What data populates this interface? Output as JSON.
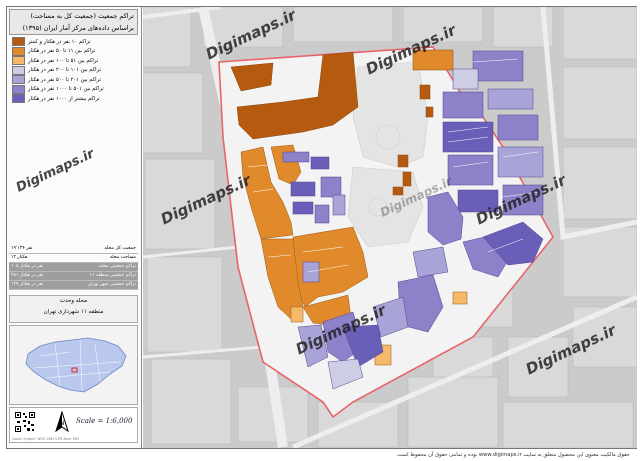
{
  "title": {
    "line1": "تراکم جمعیت (جمعیت کل به مساحت)",
    "line2": "براساس داده‌های مرکز آمار ایران (۱۳۹۵)"
  },
  "legend": [
    {
      "label": "تراکم ۱۰ نفر در هکتار و کمتر",
      "color": "#b55a0e"
    },
    {
      "label": "تراکم بین ۱۱ تا ۵۰ نفر در هکتار",
      "color": "#e08a2b"
    },
    {
      "label": "تراکم بین ۵۱ تا ۱۰۰ نفر در هکتار",
      "color": "#f5b96a"
    },
    {
      "label": "تراکم بین ۱۰۱ تا ۲۰۰ نفر در هکتار",
      "color": "#cdcde6"
    },
    {
      "label": "تراکم بین ۲۰۱ تا ۵۰۰ نفر در هکتار",
      "color": "#a9a4d7"
    },
    {
      "label": "تراکم بین ۵۰۱ تا ۱۰۰۰ نفر در هکتار",
      "color": "#8d82c9"
    },
    {
      "label": "تراکم بیشتر از ۱۰۰۰ نفر در هکتار",
      "color": "#6a5fb8"
    }
  ],
  "stats": [
    {
      "label": "جمعیت کل محله",
      "value": "۱۹٬۱۳۴ نفر"
    },
    {
      "label": "مساحت محله",
      "value": "۱۲ هکتار"
    },
    {
      "label": "تراکم جمعیتی محله",
      "value": "۱۰۸ نفر در هکتار"
    },
    {
      "label": "تراکم جمعیتی منطقه ۱۱",
      "value": "۲۸۱ نفر در هکتار"
    },
    {
      "label": "تراکم جمعیتی شهر تهران",
      "value": "۱۲۹ نفر در هکتار"
    }
  ],
  "district": {
    "name": "محله وحدت",
    "region": "منطقه ۱۱ شهرداری تهران"
  },
  "scale": "Scale = 1:6,000",
  "footer": "حقوق مالکیت معنوی این محصول متعلق به سایت www.digimaps.ir بوده و تمامی حقوق آن محفوظ است.",
  "watermark": "Digimaps.ir",
  "tiny_credit": "Coord. System: WGS 1984 UTM Zone 39N"
}
